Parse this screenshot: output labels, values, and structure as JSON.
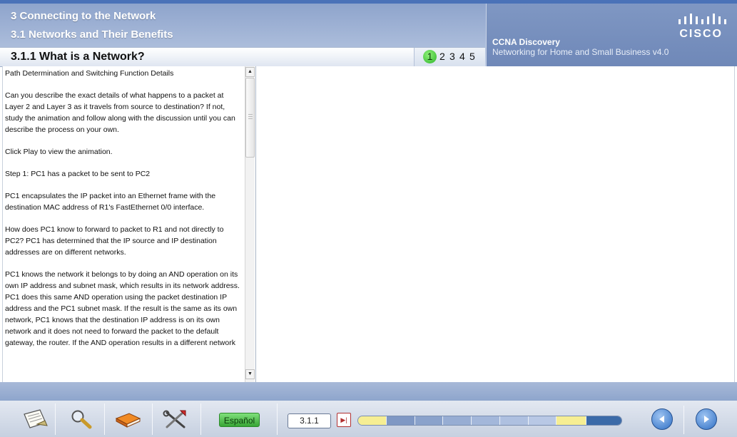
{
  "header": {
    "chapter_title": "3 Connecting to the Network",
    "section_title": "3.1 Networks and Their Benefits",
    "page_title": "3.1.1 What is a Network?",
    "pages": [
      "1",
      "2",
      "3",
      "4",
      "5"
    ],
    "current_page": "1",
    "brand": "CISCO",
    "course_title": "CCNA Discovery",
    "course_subtitle": "Networking for Home and Small Business v4.0"
  },
  "text_panel": {
    "paragraphs": [
      "Path Determination and Switching Function Details",
      "Can you describe the exact details of what happens to a packet at Layer 2 and Layer 3 as it travels from source to destination? If not, study the animation and follow along with the discussion until you can describe the process on your own.",
      "Click Play to view the animation.",
      "Step 1: PC1 has a packet to be sent to PC2",
      "PC1 encapsulates the IP packet into an Ethernet frame with the destination MAC address of R1's FastEthernet 0/0 interface.",
      "How does PC1 know to forward to packet to R1 and not directly to PC2? PC1 has determined that the IP source and IP destination addresses are on different networks.",
      "PC1 knows the network it belongs to by doing an AND operation on its own IP address and subnet mask, which results in its network address. PC1 does this same AND operation using the packet destination IP address and the PC1 subnet mask. If the result is the same as its own network, PC1 knows that the destination IP address is on its own network and it does not need to forward the packet to the default gateway, the router. If the AND operation results in a different network"
    ]
  },
  "footer": {
    "tools": [
      {
        "name": "glossary-icon"
      },
      {
        "name": "search-icon"
      },
      {
        "name": "book-icon"
      },
      {
        "name": "tools-icon"
      }
    ],
    "language_button": "Español",
    "page_id": "3.1.1",
    "progress_colors": {
      "viewed": "#f6ee93",
      "unviewed": "#8fa6cf",
      "current": "#3b6aa8"
    }
  },
  "colors": {
    "header_bg": "#9fb2d6",
    "brand_bg": "#7590c0",
    "current_page_badge": "#3ec23a",
    "language_button": "#4dbb49",
    "nav_button": "#3c7ace"
  }
}
